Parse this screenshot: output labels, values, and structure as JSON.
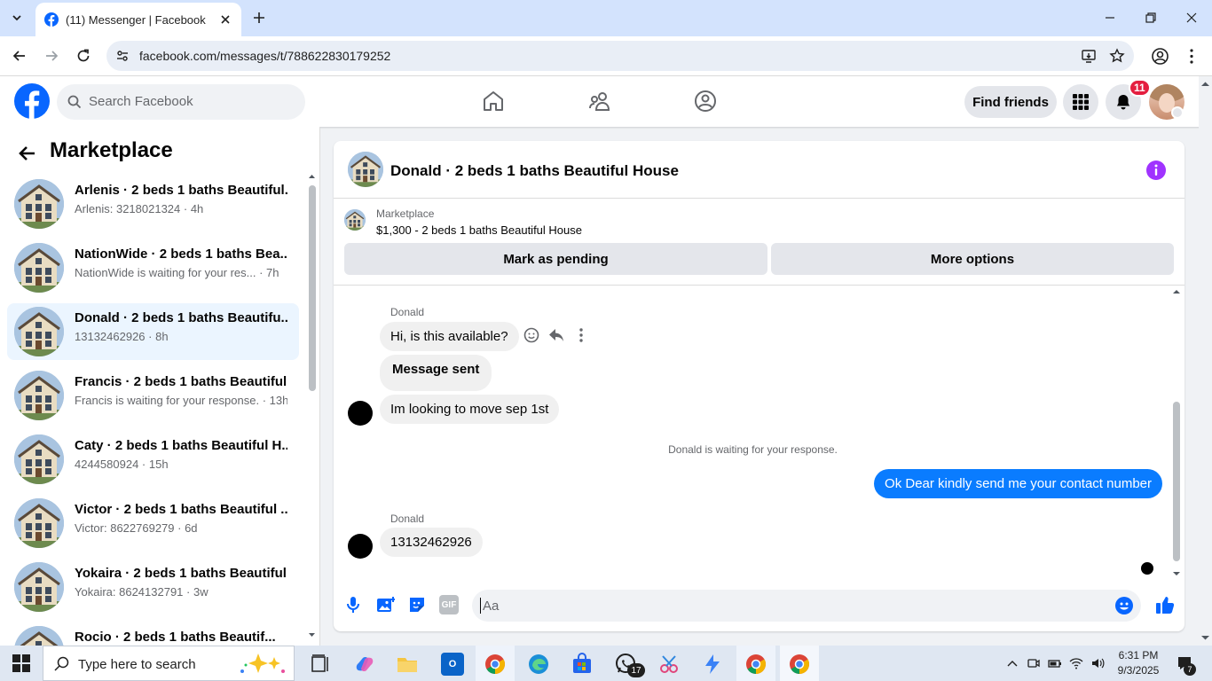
{
  "browser": {
    "tab_title": "(11) Messenger | Facebook",
    "url": "facebook.com/messages/t/788622830179252"
  },
  "fb_header": {
    "search_placeholder": "Search Facebook",
    "find_friends_label": "Find friends",
    "notification_count": "11"
  },
  "left_panel": {
    "title": "Marketplace",
    "conversations": [
      {
        "name": "Arlenis · 2 beds 1 baths Beautiful...",
        "sub": "Arlenis: 3218021324 · 4h",
        "active": false
      },
      {
        "name": "NationWide · 2 beds 1 baths Bea...",
        "sub": "NationWide is waiting for your res... · 7h",
        "active": false
      },
      {
        "name": "Donald · 2 beds 1 baths Beautifu...",
        "sub": "13132462926 · 8h",
        "active": true
      },
      {
        "name": "Francis · 2 beds 1 baths Beautiful...",
        "sub": "Francis is waiting for your response. · 13h",
        "active": false
      },
      {
        "name": "Caty · 2 beds 1 baths Beautiful H...",
        "sub": "4244580924 · 15h",
        "active": false
      },
      {
        "name": "Victor · 2 beds 1 baths Beautiful ...",
        "sub": "Victor: 8622769279 · 6d",
        "active": false
      },
      {
        "name": "Yokaira · 2 beds 1 baths Beautiful...",
        "sub": "Yokaira: 8624132791 · 3w",
        "active": false
      },
      {
        "name": "Rocio · 2 beds 1 baths Beautif...",
        "sub": "",
        "active": false
      }
    ]
  },
  "chat": {
    "title": "Donald · 2 beds 1 baths Beautiful House",
    "marketplace_label": "Marketplace",
    "listing": "$1,300 - 2 beds 1 baths Beautiful House",
    "mark_pending_label": "Mark as pending",
    "more_options_label": "More options",
    "sender_name_1": "Donald",
    "msg_1": "Hi, is this available?",
    "msg_2": "Message sent",
    "msg_3": "Im looking to move sep 1st",
    "waiting_text": "Donald is waiting for your response.",
    "msg_out": "Ok Dear kindly send me your contact number",
    "sender_name_2": "Donald",
    "msg_4": "13132462926",
    "composer_placeholder": "Aa",
    "gif_label": "GIF"
  },
  "taskbar": {
    "search_placeholder": "Type here to search",
    "whatsapp_badge": "17",
    "time": "6:31 PM",
    "date": "9/3/2025",
    "notification_count": "7"
  },
  "colors": {
    "fb_blue": "#0866ff",
    "messenger_blue": "#0a7cff",
    "active_conv_bg": "#ebf5ff",
    "info_purple": "#a033ff",
    "badge_red": "#e41e3f"
  }
}
